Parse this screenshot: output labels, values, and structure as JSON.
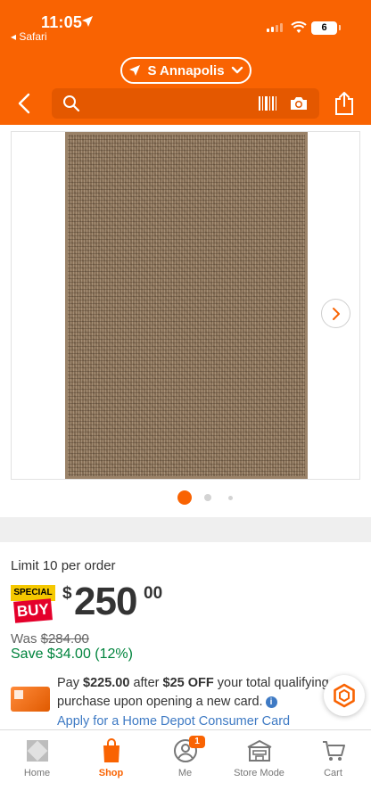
{
  "status": {
    "time": "11:05",
    "back_app": "◂ Safari",
    "battery": "6"
  },
  "header": {
    "store": "S Annapolis",
    "search_placeholder": ""
  },
  "gallery": {
    "dot_count": 3,
    "active_index": 0
  },
  "product": {
    "limit": "Limit 10 per order",
    "badge_top": "SPECIAL",
    "badge_bottom": "BUY",
    "price_currency": "$",
    "price_dollars": "250",
    "price_cents": "00",
    "was_label": "Was ",
    "was_price": "$284.00",
    "save": "Save $34.00 (12%)"
  },
  "offer": {
    "pay_prefix": "Pay ",
    "pay_amount": "$225.00",
    "pay_middle": " after ",
    "discount": "$25 OFF",
    "pay_suffix": " your total qualifying purchase upon opening a new card.",
    "info": "i",
    "apply_link": "Apply for a Home Depot Consumer Card"
  },
  "tabs": [
    {
      "label": "Home",
      "icon": "home-depot-logo-icon",
      "active": false
    },
    {
      "label": "Shop",
      "icon": "shop-bag-icon",
      "active": true
    },
    {
      "label": "Me",
      "icon": "person-icon",
      "active": false,
      "badge": "1"
    },
    {
      "label": "Store Mode",
      "icon": "store-icon",
      "active": false
    },
    {
      "label": "Cart",
      "icon": "cart-icon",
      "active": false
    }
  ],
  "colors": {
    "brand": "#f96302",
    "save_green": "#00843d",
    "link_blue": "#3e7ac4"
  }
}
